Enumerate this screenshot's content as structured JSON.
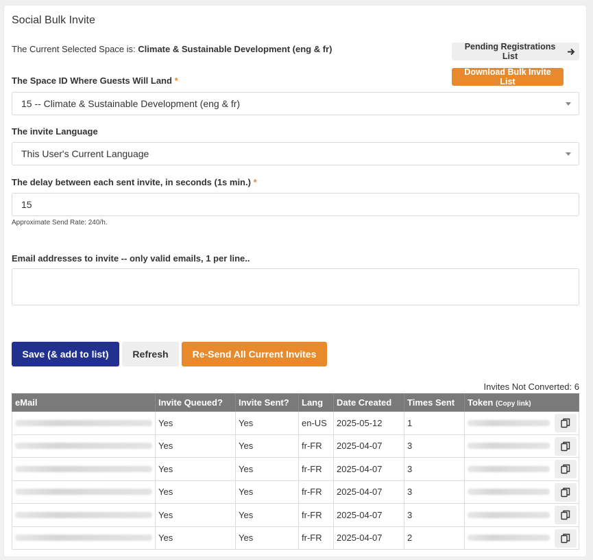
{
  "panel": {
    "title": "Social Bulk Invite",
    "current_space_prefix": "The Current Selected Space is:",
    "current_space_name": "Climate & Sustainable Development (eng & fr)"
  },
  "buttons": {
    "pending": "Pending Registrations List",
    "download": "Download Bulk Invite List",
    "save": "Save (& add to list)",
    "refresh": "Refresh",
    "resend": "Re-Send All Current Invites"
  },
  "form": {
    "space_label": "The Space ID Where Guests Will Land",
    "space_value": "15 -- Climate & Sustainable Development (eng & fr)",
    "language_label": "The invite Language",
    "language_value": "This User's Current Language",
    "delay_label": "The delay between each sent invite, in seconds (1s min.)",
    "delay_value": "15",
    "send_rate_hint": "Approximate Send Rate: 240/h.",
    "emails_label": "Email addresses to invite -- only valid emails, 1 per line..",
    "emails_value": "",
    "required_mark": "*"
  },
  "table": {
    "not_converted": "Invites Not Converted: 6",
    "headers": {
      "email": "eMail",
      "queued": "Invite Queued?",
      "sent": "Invite Sent?",
      "lang": "Lang",
      "date": "Date Created",
      "times": "Times Sent",
      "token": "Token",
      "token_small": "(Copy link)"
    },
    "rows": [
      {
        "queued": "Yes",
        "sent": "Yes",
        "lang": "en-US",
        "date": "2025-05-12",
        "times": "1"
      },
      {
        "queued": "Yes",
        "sent": "Yes",
        "lang": "fr-FR",
        "date": "2025-04-07",
        "times": "3"
      },
      {
        "queued": "Yes",
        "sent": "Yes",
        "lang": "fr-FR",
        "date": "2025-04-07",
        "times": "3"
      },
      {
        "queued": "Yes",
        "sent": "Yes",
        "lang": "fr-FR",
        "date": "2025-04-07",
        "times": "3"
      },
      {
        "queued": "Yes",
        "sent": "Yes",
        "lang": "fr-FR",
        "date": "2025-04-07",
        "times": "3"
      },
      {
        "queued": "Yes",
        "sent": "Yes",
        "lang": "fr-FR",
        "date": "2025-04-07",
        "times": "2"
      }
    ]
  },
  "icons": {
    "pending_arrow": "arrow-right-icon",
    "select_caret": "caret-down-icon",
    "copy": "copy-icon"
  },
  "colors": {
    "primary": "#22318f",
    "accent": "#e8892b",
    "table_header": "#7a7a7a"
  }
}
